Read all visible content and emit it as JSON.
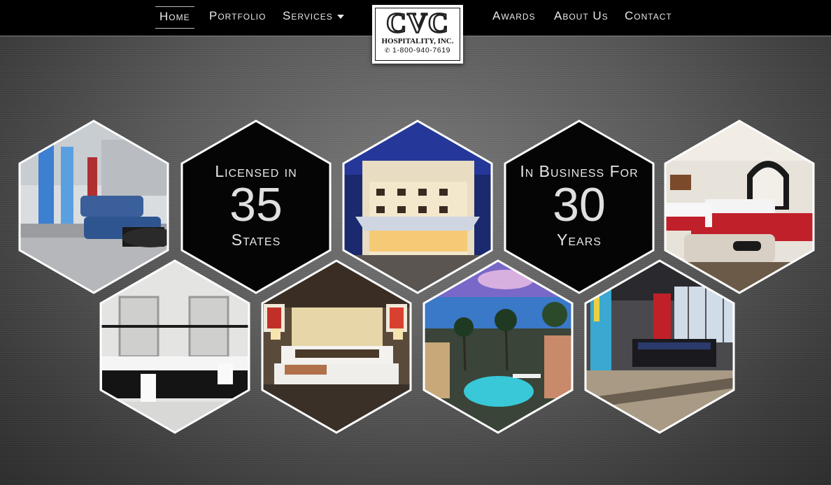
{
  "nav": {
    "home": "Home",
    "portfolio": "Portfolio",
    "services": "Services",
    "awards": "Awards",
    "about": "About Us",
    "contact": "Contact"
  },
  "logo": {
    "letters": "CVC",
    "name": "HOSPITALITY, INC.",
    "phone": "1-800-940-7619"
  },
  "stats": [
    {
      "top": "Licensed in",
      "number": "35",
      "bottom": "States"
    },
    {
      "top": "In Business For",
      "number": "30",
      "bottom": "Years"
    }
  ],
  "photos": [
    "hotel lobby with blue sofas",
    "hotel exterior at dusk",
    "guest room with red bedding",
    "hotel bathroom vanity",
    "hotel bedroom",
    "waterfront pool resort",
    "hotel lobby with front desk"
  ],
  "colors": {
    "navbar": "#000000",
    "hex_stroke": "#ffffff",
    "stat_fill": "#050505",
    "nav_text": "#e8e8e8"
  }
}
